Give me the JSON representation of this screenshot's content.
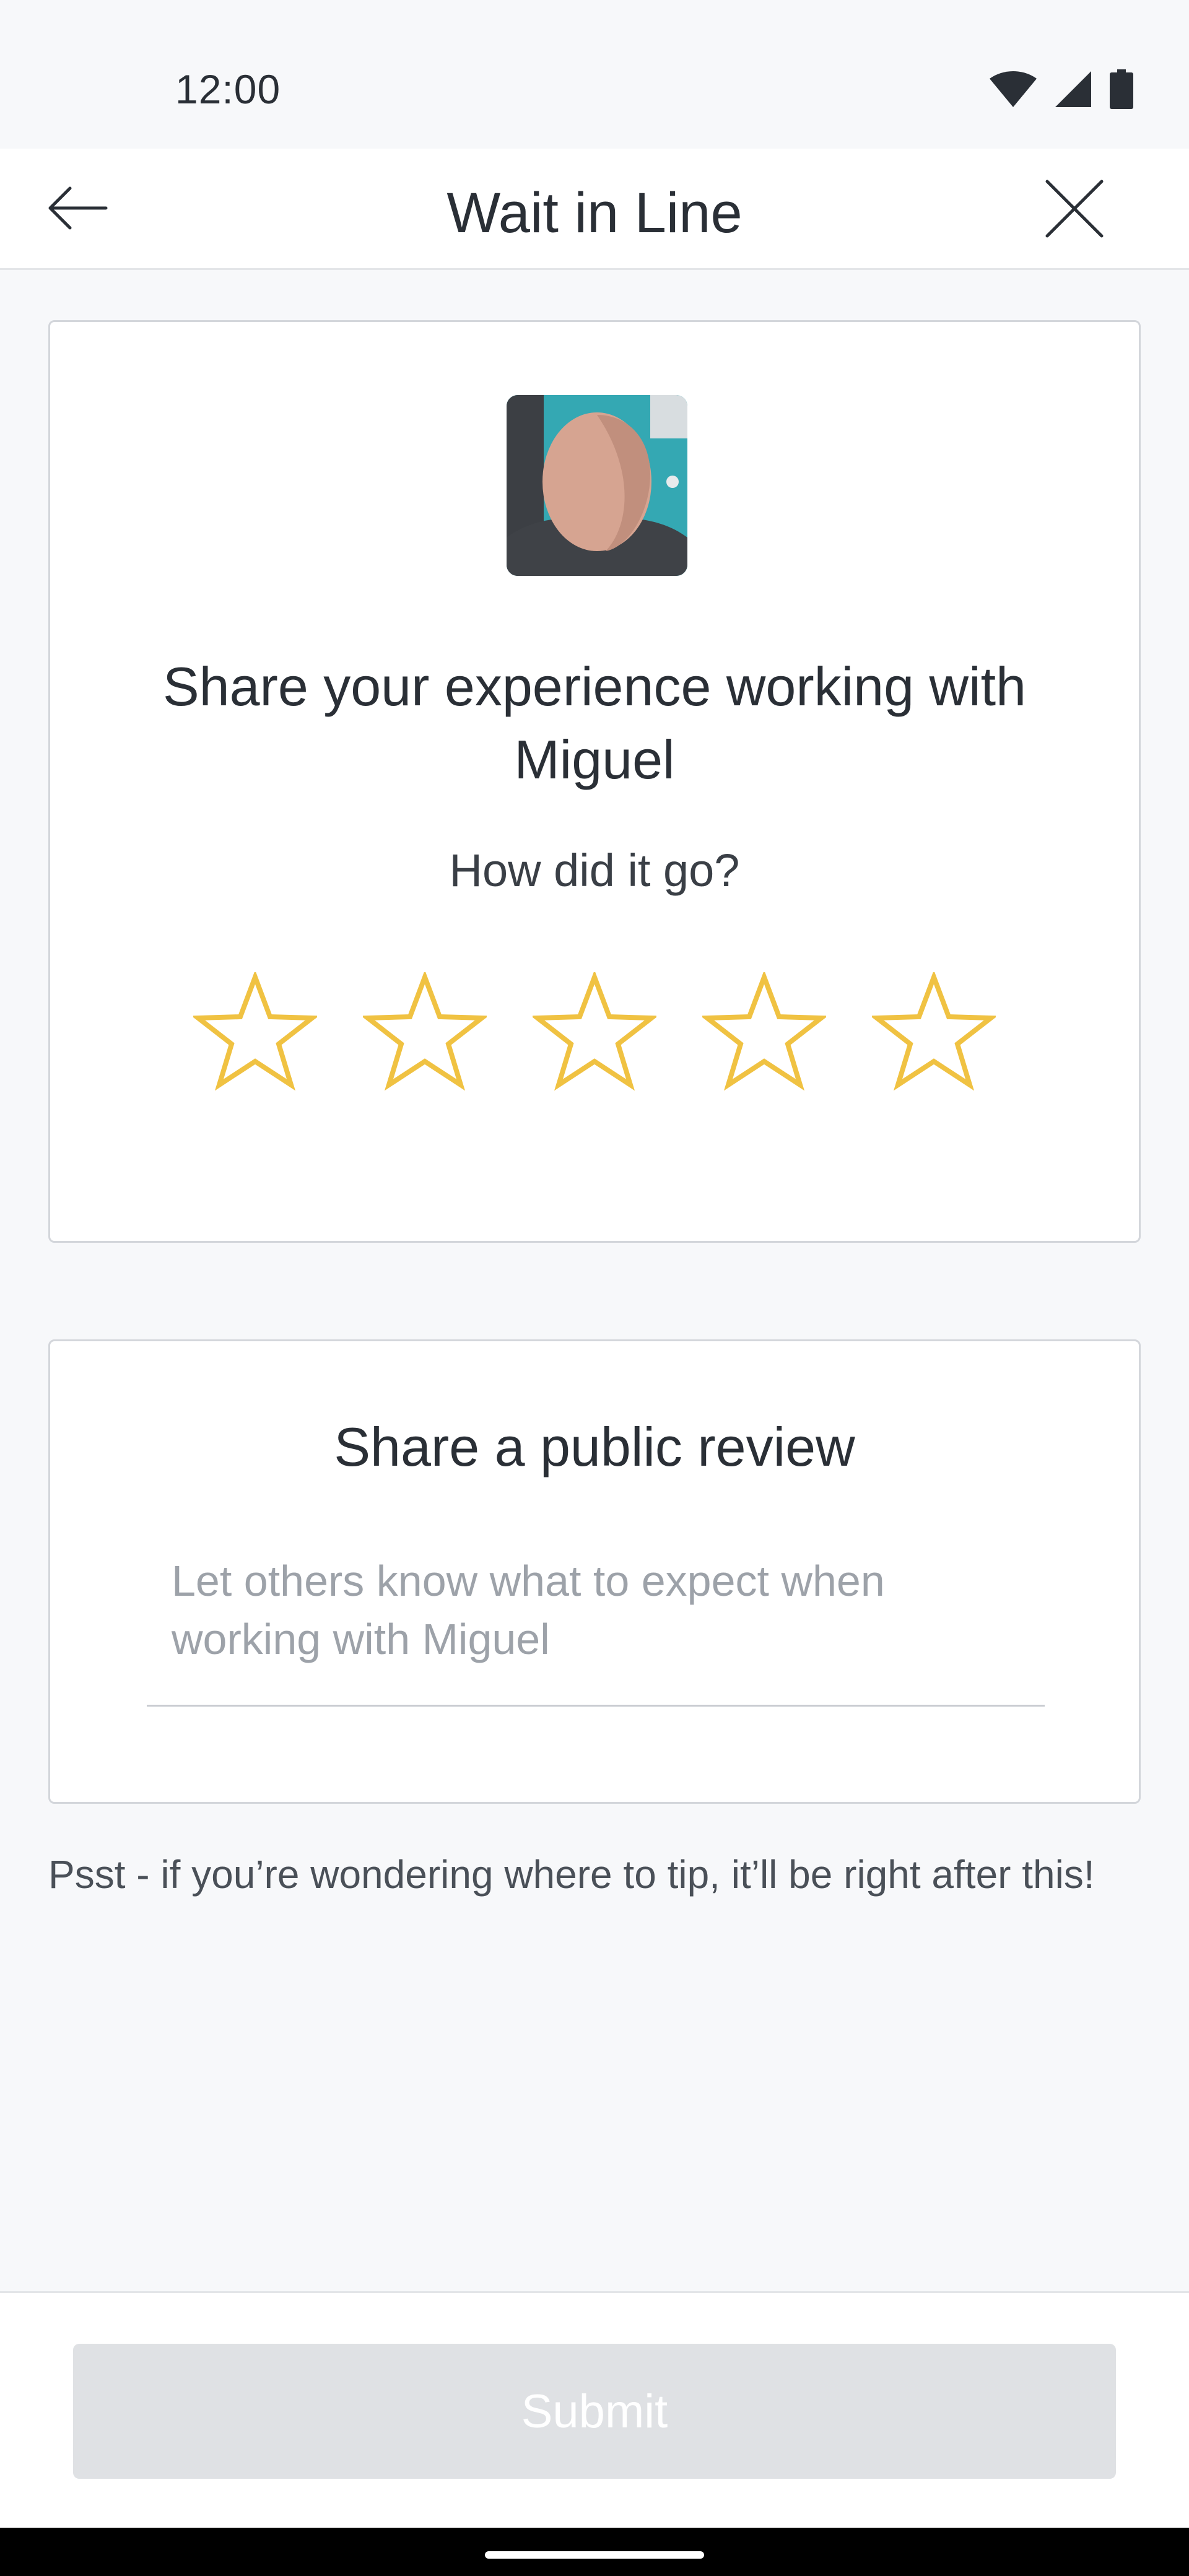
{
  "status_bar": {
    "time": "12:00",
    "icons": [
      "wifi-icon",
      "cellular-signal-icon",
      "battery-icon"
    ]
  },
  "header": {
    "title": "Wait in Line",
    "back_icon": "arrow-left-icon",
    "close_icon": "close-icon"
  },
  "rating_card": {
    "avatar_alt": "Miguel",
    "heading": "Share your experience working with Miguel",
    "subheading": "How did it go?",
    "rating": {
      "value": 0,
      "max": 5
    },
    "star_color": "#f0c242"
  },
  "review_card": {
    "heading": "Share a public review",
    "placeholder": "Let others know what to expect when working with Miguel",
    "value": ""
  },
  "tip_note": "Psst - if you’re wondering where to tip, it’ll be right after this!",
  "footer": {
    "submit_label": "Submit",
    "submit_enabled": false
  },
  "colors": {
    "background": "#f7f8fa",
    "text": "#2a2f36",
    "placeholder": "#9da2a9",
    "submit_disabled_bg": "#dfe1e4",
    "star": "#f0c242"
  }
}
